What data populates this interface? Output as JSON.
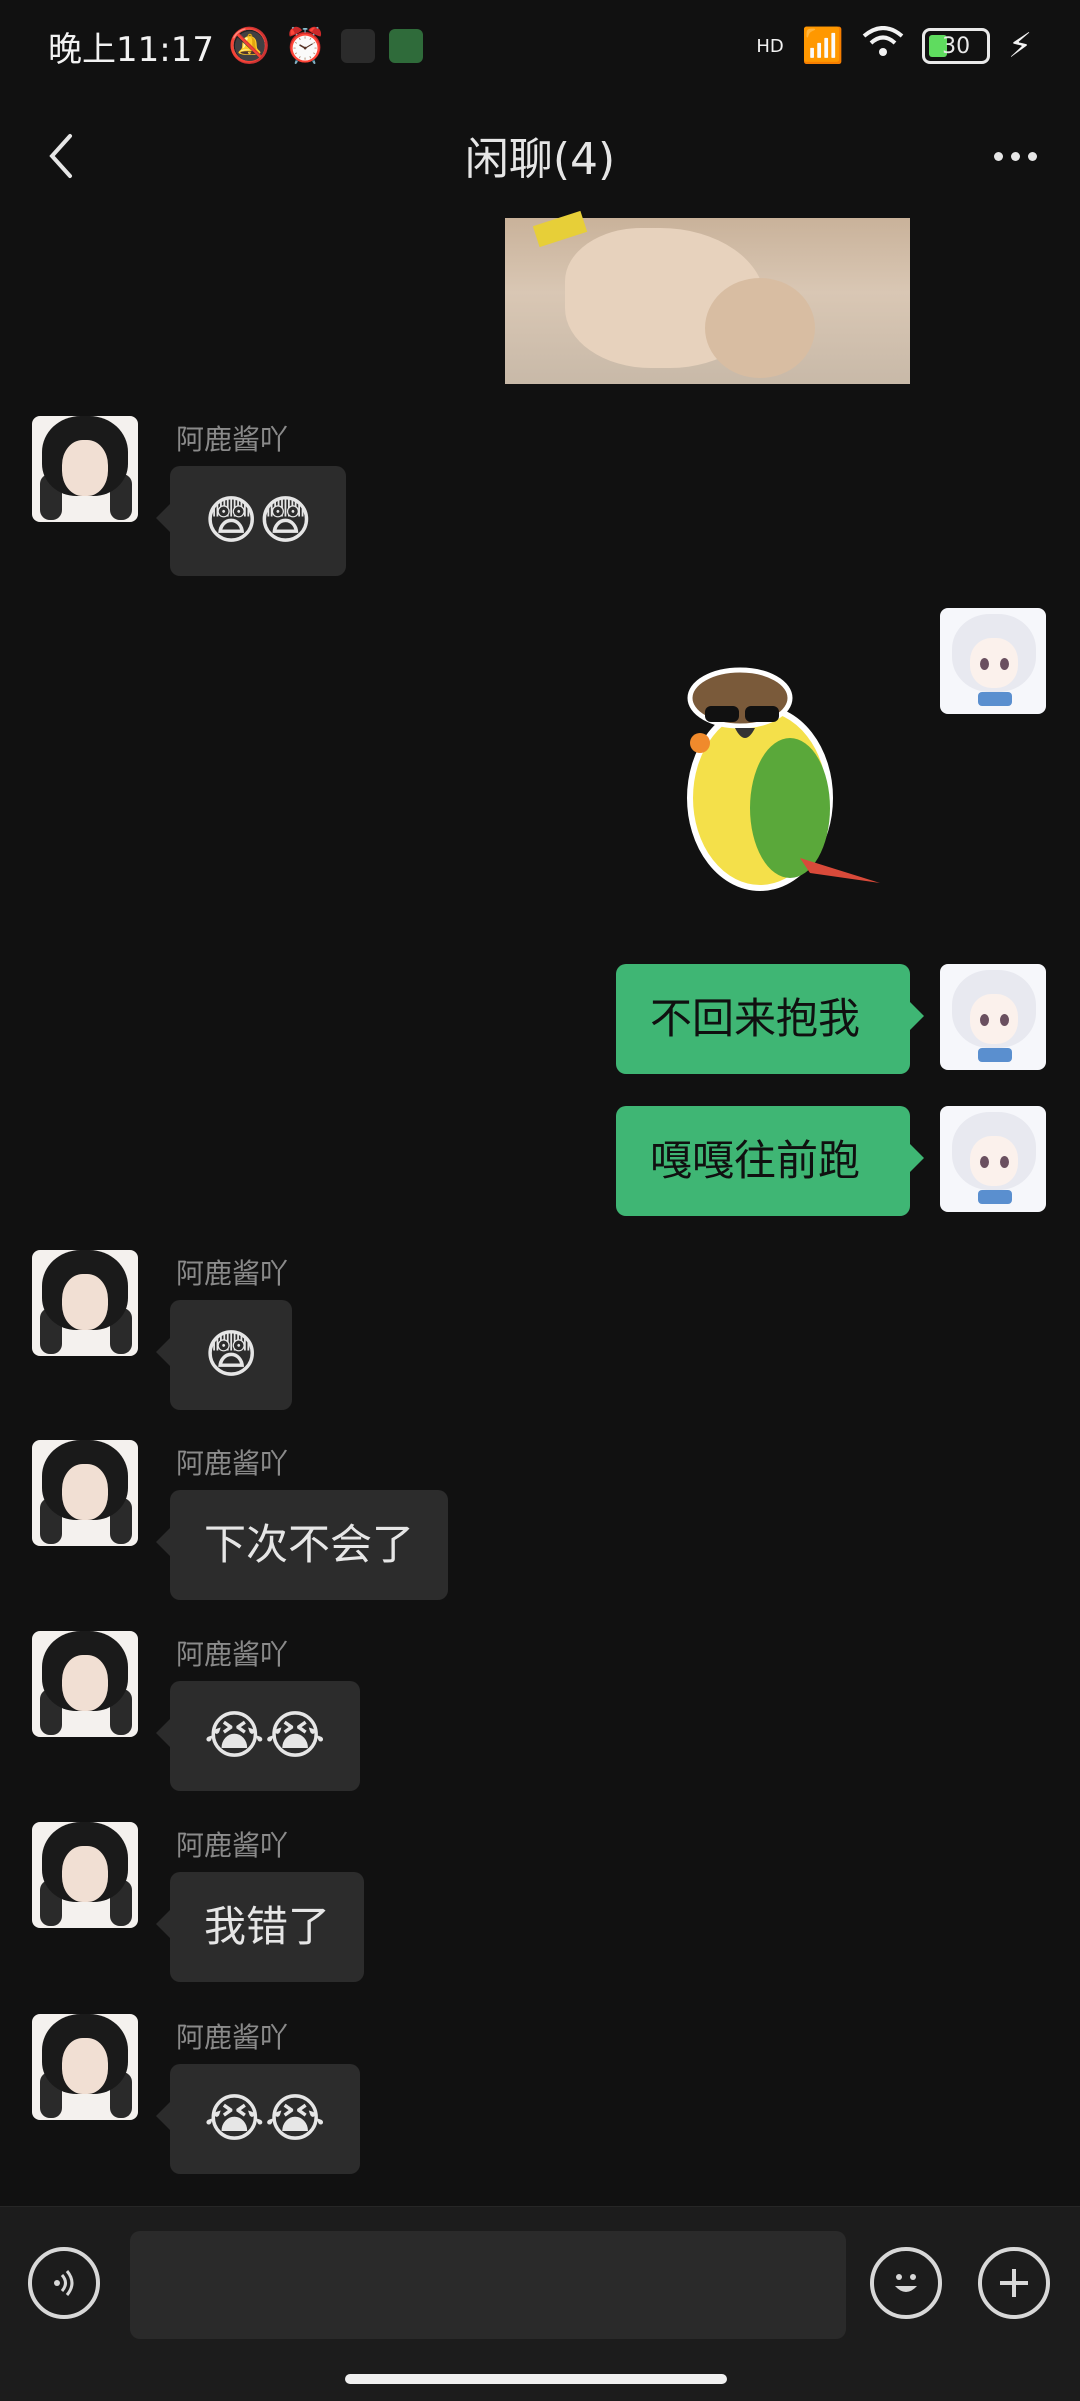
{
  "status_bar": {
    "time": "晚上11:17",
    "network": "HD",
    "battery": "30"
  },
  "header": {
    "title": "闲聊(4)"
  },
  "messages": [
    {
      "type": "image",
      "direction": "incoming"
    },
    {
      "sender": "阿鹿酱吖",
      "direction": "incoming",
      "text": "😨😨"
    },
    {
      "type": "sticker",
      "direction": "outgoing"
    },
    {
      "direction": "outgoing",
      "text": "不回来抱我"
    },
    {
      "direction": "outgoing",
      "text": "嘎嘎往前跑"
    },
    {
      "sender": "阿鹿酱吖",
      "direction": "incoming",
      "text": "😨"
    },
    {
      "sender": "阿鹿酱吖",
      "direction": "incoming",
      "text": "下次不会了"
    },
    {
      "sender": "阿鹿酱吖",
      "direction": "incoming",
      "text": "😭😭"
    },
    {
      "sender": "阿鹿酱吖",
      "direction": "incoming",
      "text": "我错了"
    },
    {
      "sender": "阿鹿酱吖",
      "direction": "incoming",
      "text": "😭😭"
    }
  ],
  "input_bar": {
    "voice_icon": "voice-icon",
    "emoji_icon": "emoji-icon",
    "add_icon": "plus-icon",
    "placeholder": ""
  },
  "colors": {
    "background": "#111111",
    "incoming_bubble": "#2c2c2c",
    "outgoing_bubble": "#3fb674"
  }
}
